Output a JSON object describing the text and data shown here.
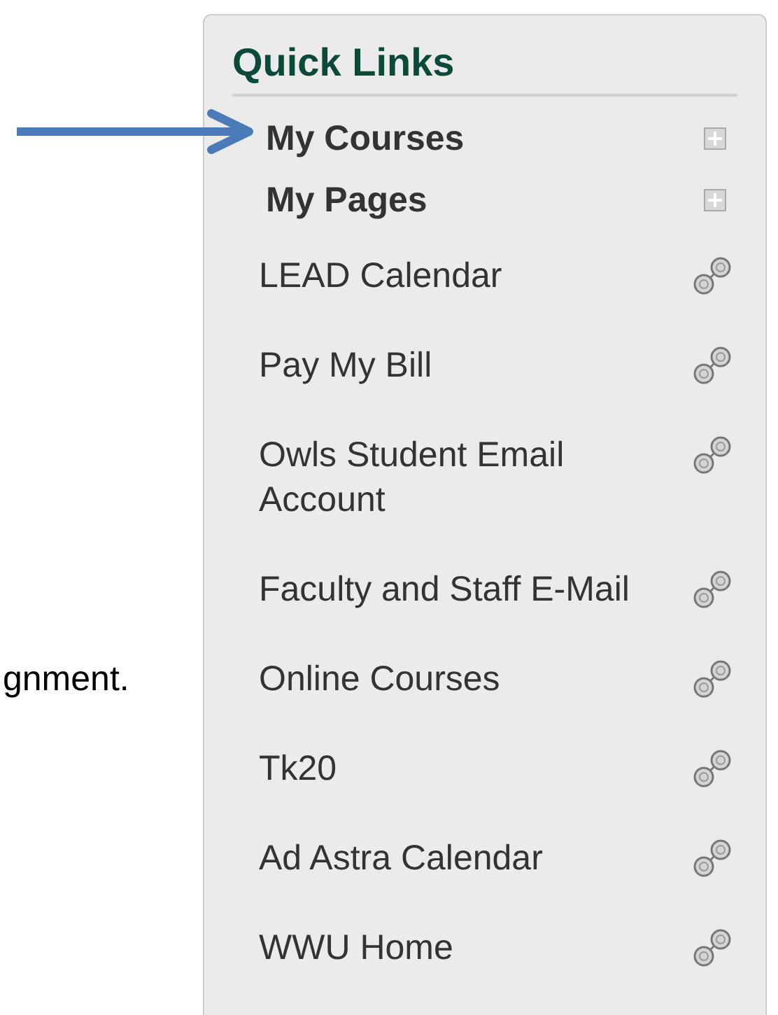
{
  "side_text": "gnment.",
  "panel": {
    "title": "Quick Links",
    "items": [
      {
        "label": "My Courses",
        "kind": "group"
      },
      {
        "label": "My Pages",
        "kind": "group"
      },
      {
        "label": "LEAD Calendar",
        "kind": "link"
      },
      {
        "label": "Pay My Bill",
        "kind": "link"
      },
      {
        "label": "Owls Student Email Account",
        "kind": "link"
      },
      {
        "label": "Faculty and Staff E-Mail",
        "kind": "link"
      },
      {
        "label": "Online Courses",
        "kind": "link"
      },
      {
        "label": "Tk20",
        "kind": "link"
      },
      {
        "label": "Ad Astra Calendar",
        "kind": "link"
      },
      {
        "label": "WWU Home",
        "kind": "link"
      }
    ]
  }
}
